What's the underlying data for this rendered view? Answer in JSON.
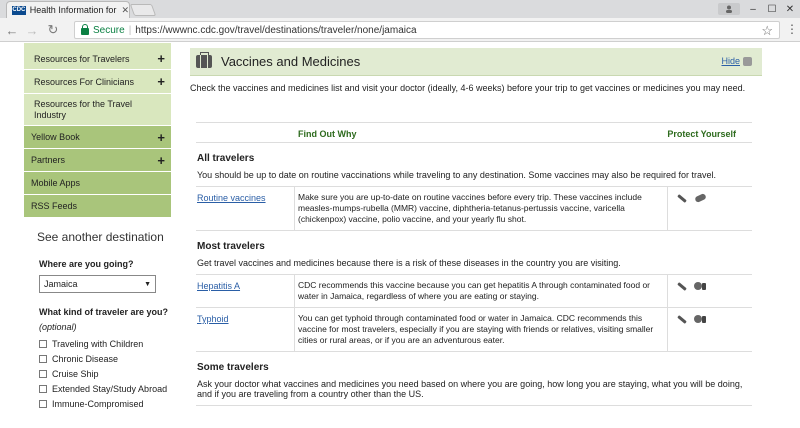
{
  "browser": {
    "tab_title": "Health Information for Tr",
    "favicon_text": "CDC",
    "secure_label": "Secure",
    "url": "https://wwwnc.cdc.gov/travel/destinations/traveler/none/jamaica"
  },
  "sidebar": {
    "items": [
      {
        "label": "Resources for Travelers",
        "plus": "+",
        "style": "light"
      },
      {
        "label": "Resources For Clinicians",
        "plus": "+",
        "style": "light"
      },
      {
        "label": "Resources for the Travel Industry",
        "plus": "",
        "style": "light"
      },
      {
        "label": "Yellow Book",
        "plus": "+",
        "style": "dark"
      },
      {
        "label": "Partners",
        "plus": "+",
        "style": "dark"
      },
      {
        "label": "Mobile Apps",
        "plus": "",
        "style": "dark"
      },
      {
        "label": "RSS Feeds",
        "plus": "",
        "style": "dark"
      }
    ],
    "another_destination": "See another destination",
    "where_label": "Where are you going?",
    "where_value": "Jamaica",
    "traveler_label": "What kind of traveler are you?",
    "optional": "(optional)",
    "traveler_types": [
      "Traveling with Children",
      "Chronic Disease",
      "Cruise Ship",
      "Extended Stay/Study Abroad",
      "Immune-Compromised"
    ]
  },
  "section": {
    "title": "Vaccines and Medicines",
    "hide_label": "Hide",
    "intro": "Check the vaccines and medicines list and visit your doctor (ideally, 4-6 weeks) before your trip to get vaccines or medicines you may need."
  },
  "table": {
    "col_find": "Find Out Why",
    "col_protect": "Protect Yourself",
    "groups": [
      {
        "title": "All travelers",
        "desc": "You should be up to date on routine vaccinations while traveling to any destination. Some vaccines may also be required for travel.",
        "rows": [
          {
            "name": "Routine vaccines",
            "desc": "Make sure you are up-to-date on routine vaccines before every trip. These vaccines include measles-mumps-rubella (MMR) vaccine, diphtheria-tetanus-pertussis vaccine, varicella (chickenpox) vaccine, polio vaccine, and your yearly flu shot.",
            "icons": [
              "syringe-icon",
              "pill-icon"
            ]
          }
        ]
      },
      {
        "title": "Most travelers",
        "desc": "Get travel vaccines and medicines because there is a risk of these diseases in the country you are visiting.",
        "rows": [
          {
            "name": "Hepatitis A",
            "desc": "CDC recommends this vaccine because you can get hepatitis A through contaminated food or water in Jamaica, regardless of where you are eating or staying.",
            "icons": [
              "syringe-icon",
              "food-water-icon"
            ]
          },
          {
            "name": "Typhoid",
            "desc": "You can get typhoid through contaminated food or water in Jamaica. CDC recommends this vaccine for most travelers, especially if you are staying with friends or relatives, visiting smaller cities or rural areas, or if you are an adventurous eater.",
            "icons": [
              "syringe-icon",
              "food-water-icon"
            ]
          }
        ]
      },
      {
        "title": "Some travelers",
        "desc": "Ask your doctor what vaccines and medicines you need based on where you are going, how long you are staying, what you will be doing, and if you are traveling from a country other than the US.",
        "rows": []
      }
    ]
  }
}
